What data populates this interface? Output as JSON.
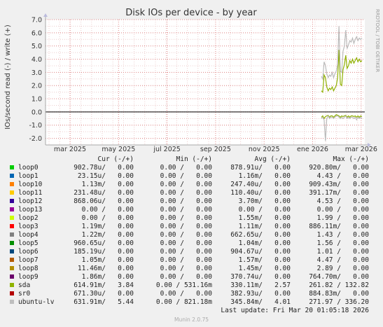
{
  "chart_data": {
    "type": "line",
    "title": "Disk IOs per device - by year",
    "ylabel": "IOs/second read (-) / write (+)",
    "side_label": "RRDTOOL / TOBI OETIKER",
    "ylim": [
      -2.5,
      7.0
    ],
    "yticks": [
      "-2.0",
      "-1.0",
      "0.0",
      "1.0",
      "2.0",
      "3.0",
      "4.0",
      "5.0",
      "6.0",
      "7.0"
    ],
    "ytick_values": [
      -2,
      -1,
      0,
      1,
      2,
      3,
      4,
      5,
      6,
      7
    ],
    "xticks": [
      "mar 2025",
      "may 2025",
      "jul 2025",
      "sep 2025",
      "nov 2025",
      "ene 2026",
      "mar 2026"
    ],
    "colors": {
      "background": "#f0f0f0",
      "plot_background": "#ffffff",
      "grid_minor": "#eccccc",
      "grid_major": "#e08888",
      "zero_line": "#000000",
      "axis": "#aaaaaa",
      "arrow": "#bbbbdd"
    },
    "series": [
      {
        "name": "sda",
        "color": "#8fb000",
        "write": [
          [
            0.0,
            1.6
          ],
          [
            0.1,
            1.5
          ],
          [
            0.2,
            2.8
          ],
          [
            0.3,
            2.6
          ],
          [
            0.4,
            1.9
          ],
          [
            0.5,
            1.6
          ],
          [
            0.6,
            1.8
          ],
          [
            0.7,
            1.7
          ],
          [
            0.8,
            1.9
          ],
          [
            0.9,
            1.6
          ],
          [
            1.0,
            1.8
          ],
          [
            1.1,
            2.0
          ],
          [
            1.2,
            2.6
          ],
          [
            1.3,
            4.7
          ],
          [
            1.4,
            2.1
          ],
          [
            1.5,
            2.0
          ],
          [
            1.6,
            3.2
          ],
          [
            1.7,
            3.6
          ],
          [
            1.8,
            4.3
          ],
          [
            1.9,
            3.3
          ],
          [
            2.0,
            3.5
          ],
          [
            2.1,
            3.9
          ],
          [
            2.2,
            3.7
          ],
          [
            2.3,
            4.0
          ],
          [
            2.4,
            3.7
          ],
          [
            2.5,
            3.9
          ],
          [
            2.6,
            4.1
          ],
          [
            2.7,
            3.8
          ],
          [
            2.8,
            4.0
          ],
          [
            2.9,
            3.8
          ],
          [
            3.0,
            3.9
          ]
        ],
        "read": [
          [
            0.0,
            -0.4
          ],
          [
            0.1,
            -0.3
          ],
          [
            0.2,
            -0.5
          ],
          [
            0.3,
            -0.35
          ],
          [
            0.4,
            -0.3
          ],
          [
            0.5,
            -0.25
          ],
          [
            0.6,
            -0.4
          ],
          [
            0.7,
            -0.3
          ],
          [
            0.8,
            -0.3
          ],
          [
            0.9,
            -0.4
          ],
          [
            1.0,
            -0.3
          ],
          [
            1.1,
            -0.2
          ],
          [
            1.2,
            -0.25
          ],
          [
            1.3,
            -0.3
          ],
          [
            1.4,
            -0.4
          ],
          [
            1.5,
            -0.3
          ],
          [
            1.6,
            -0.35
          ],
          [
            1.7,
            -0.3
          ],
          [
            1.8,
            -0.25
          ],
          [
            1.9,
            -0.4
          ],
          [
            2.0,
            -0.3
          ],
          [
            2.1,
            -0.4
          ],
          [
            2.2,
            -0.3
          ],
          [
            2.3,
            -0.3
          ],
          [
            2.4,
            -0.35
          ],
          [
            2.5,
            -0.3
          ],
          [
            2.6,
            -0.4
          ],
          [
            2.7,
            -0.3
          ],
          [
            2.8,
            -0.4
          ],
          [
            2.9,
            -0.3
          ],
          [
            3.0,
            -0.35
          ]
        ]
      },
      {
        "name": "ubuntu-lv",
        "color": "#bbbbbb",
        "write": [
          [
            0.0,
            2.7
          ],
          [
            0.1,
            2.5
          ],
          [
            0.2,
            3.8
          ],
          [
            0.3,
            3.5
          ],
          [
            0.4,
            2.9
          ],
          [
            0.5,
            2.6
          ],
          [
            0.6,
            2.8
          ],
          [
            0.7,
            2.7
          ],
          [
            0.8,
            3.0
          ],
          [
            0.9,
            2.6
          ],
          [
            1.0,
            2.9
          ],
          [
            1.1,
            3.1
          ],
          [
            1.2,
            3.6
          ],
          [
            1.3,
            6.5
          ],
          [
            1.4,
            3.1
          ],
          [
            1.5,
            3.0
          ],
          [
            1.6,
            4.6
          ],
          [
            1.7,
            5.0
          ],
          [
            1.8,
            6.2
          ],
          [
            1.9,
            4.8
          ],
          [
            2.0,
            5.1
          ],
          [
            2.1,
            5.4
          ],
          [
            2.2,
            5.3
          ],
          [
            2.3,
            5.6
          ],
          [
            2.4,
            5.2
          ],
          [
            2.5,
            5.5
          ],
          [
            2.6,
            5.7
          ],
          [
            2.7,
            5.4
          ],
          [
            2.8,
            5.6
          ],
          [
            2.9,
            5.5
          ],
          [
            3.0,
            5.6
          ]
        ],
        "read": [
          [
            0.0,
            -0.5
          ],
          [
            0.1,
            -0.4
          ],
          [
            0.2,
            -0.6
          ],
          [
            0.3,
            -2.2
          ],
          [
            0.4,
            -0.5
          ],
          [
            0.5,
            -0.3
          ],
          [
            0.6,
            -0.5
          ],
          [
            0.7,
            -0.4
          ],
          [
            0.8,
            -0.4
          ],
          [
            0.9,
            -0.5
          ],
          [
            1.0,
            -0.4
          ],
          [
            1.1,
            -0.3
          ],
          [
            1.2,
            -0.3
          ],
          [
            1.3,
            -0.4
          ],
          [
            1.4,
            -0.5
          ],
          [
            1.5,
            -0.4
          ],
          [
            1.6,
            -0.5
          ],
          [
            1.7,
            -0.4
          ],
          [
            1.8,
            -0.3
          ],
          [
            1.9,
            -0.5
          ],
          [
            2.0,
            -0.4
          ],
          [
            2.1,
            -0.5
          ],
          [
            2.2,
            -0.4
          ],
          [
            2.3,
            -0.4
          ],
          [
            2.4,
            -0.5
          ],
          [
            2.5,
            -0.4
          ],
          [
            2.6,
            -0.6
          ],
          [
            2.7,
            -0.4
          ],
          [
            2.8,
            -0.5
          ],
          [
            2.9,
            -0.4
          ],
          [
            3.0,
            -0.5
          ]
        ]
      }
    ]
  },
  "legend": {
    "headers": {
      "cur": "Cur (-/+)",
      "min": "Min (-/+)",
      "avg": "Avg (-/+)",
      "max": "Max (-/+)"
    },
    "rows": [
      {
        "name": "loop0",
        "color": "#00cc00",
        "cur": "902.78u/   0.00",
        "min": "0.00 /   0.00",
        "avg": "878.91u/   0.00",
        "max": "920.80m/   0.00"
      },
      {
        "name": "loop1",
        "color": "#0066b3",
        "cur": "23.15u/   0.00",
        "min": "0.00 /   0.00",
        "avg": "1.16m/   0.00",
        "max": "4.43 /   0.00"
      },
      {
        "name": "loop10",
        "color": "#ff8000",
        "cur": "1.13m/   0.00",
        "min": "0.00 /   0.00",
        "avg": "247.40u/   0.00",
        "max": "909.43m/   0.00"
      },
      {
        "name": "loop11",
        "color": "#ffcc00",
        "cur": "231.48u/   0.00",
        "min": "0.00 /   0.00",
        "avg": "110.40u/   0.00",
        "max": "391.17m/   0.00"
      },
      {
        "name": "loop12",
        "color": "#330099",
        "cur": "868.06u/   0.00",
        "min": "0.00 /   0.00",
        "avg": "3.70m/   0.00",
        "max": "4.53 /   0.00"
      },
      {
        "name": "loop13",
        "color": "#990099",
        "cur": "0.00 /   0.00",
        "min": "0.00 /   0.00",
        "avg": "0.00 /   0.00",
        "max": "0.00 /   0.00"
      },
      {
        "name": "loop2",
        "color": "#ccff00",
        "cur": "0.00 /   0.00",
        "min": "0.00 /   0.00",
        "avg": "1.55m/   0.00",
        "max": "1.99 /   0.00"
      },
      {
        "name": "loop3",
        "color": "#ff0000",
        "cur": "1.19m/   0.00",
        "min": "0.00 /   0.00",
        "avg": "1.11m/   0.00",
        "max": "886.11m/   0.00"
      },
      {
        "name": "loop4",
        "color": "#808080",
        "cur": "1.22m/   0.00",
        "min": "0.00 /   0.00",
        "avg": "662.65u/   0.00",
        "max": "1.43 /   0.00"
      },
      {
        "name": "loop5",
        "color": "#008f00",
        "cur": "960.65u/   0.00",
        "min": "0.00 /   0.00",
        "avg": "1.04m/   0.00",
        "max": "1.56 /   0.00"
      },
      {
        "name": "loop6",
        "color": "#00487d",
        "cur": "185.19u/   0.00",
        "min": "0.00 /   0.00",
        "avg": "904.67u/   0.00",
        "max": "1.01 /   0.00"
      },
      {
        "name": "loop7",
        "color": "#b35a00",
        "cur": "1.05m/   0.00",
        "min": "0.00 /   0.00",
        "avg": "1.57m/   0.00",
        "max": "4.47 /   0.00"
      },
      {
        "name": "loop8",
        "color": "#b38f00",
        "cur": "11.46m/   0.00",
        "min": "0.00 /   0.00",
        "avg": "1.45m/   0.00",
        "max": "2.89 /   0.00"
      },
      {
        "name": "loop9",
        "color": "#6b006b",
        "cur": "1.86m/   0.00",
        "min": "0.00 /   0.00",
        "avg": "370.74u/   0.00",
        "max": "764.70m/   0.00"
      },
      {
        "name": "sda",
        "color": "#8fb300",
        "cur": "614.91m/   3.84",
        "min": "0.00 / 531.16m",
        "avg": "330.11m/   2.57",
        "max": "261.82 / 132.82"
      },
      {
        "name": "sr0",
        "color": "#b30000",
        "cur": "671.30u/   0.00",
        "min": "0.00 /   0.00",
        "avg": "382.93u/   0.00",
        "max": "884.83m/   0.00"
      },
      {
        "name": "ubuntu-lv",
        "color": "#bebebe",
        "cur": "631.91m/   5.44",
        "min": "0.00 / 821.18m",
        "avg": "345.84m/   4.01",
        "max": "271.97 / 336.20"
      }
    ]
  },
  "last_update": "Last update: Fri Mar 20 01:05:18 2026",
  "footer": "Munin 2.0.75"
}
